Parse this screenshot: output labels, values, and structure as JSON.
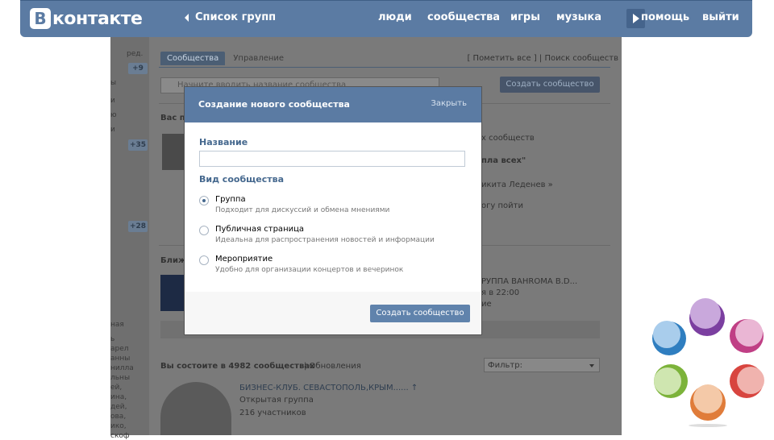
{
  "header": {
    "logo_letter": "В",
    "logo_text": "контакте",
    "back_label": "Список групп",
    "nav": [
      "люди",
      "сообщества",
      "игры",
      "музыка",
      "помощь",
      "выйти"
    ]
  },
  "background": {
    "left_text": [
      "ред.",
      "ы",
      "и",
      "ю",
      "и",
      "ная",
      "ь",
      "арел",
      "анны",
      "нилла",
      "льны",
      "ей,",
      "ина,",
      "дей,",
      "ова,",
      "ико,",
      "скоф"
    ],
    "counters": [
      "+9",
      "+35",
      "+28"
    ],
    "tabs": {
      "active": "Сообщества",
      "other": "Управление"
    },
    "tab_links": "[ Пометить все ] | Поиск сообществ",
    "search_placeholder": "Начните вводить название сообщества",
    "create_button": "Создать сообщество",
    "invites_heading": "Вас пр",
    "right_texts": [
      "х сообществ",
      "пла всех\"",
      "икита Леденев »",
      "огу пойти"
    ],
    "nearby_heading": "Ближ",
    "event_title": "РУППА BAHROMA B.D...",
    "event_time": "я в 22:00",
    "event_extra": "ие",
    "groups_count": "Вы состоите в 4982 сообществах",
    "updates": "| Обновления",
    "filter": "Фильтр:",
    "group_title": "БИЗНЕС-КЛУБ. СЕВАСТОПОЛЬ,КРЫМ...... ↑",
    "group_type": "Открытая группа",
    "group_members": "216 участников"
  },
  "modal": {
    "title": "Создание нового сообщества",
    "close": "Закрыть",
    "name_label": "Название",
    "type_label": "Вид сообщества",
    "options": [
      {
        "title": "Группа",
        "desc": "Подходит для дискуссий и обмена мнениями",
        "selected": true
      },
      {
        "title": "Публичная страница",
        "desc": "Идеальна для распространения новостей и информации",
        "selected": false
      },
      {
        "title": "Мероприятие",
        "desc": "Удобно для организации концертов и вечеринок",
        "selected": false
      }
    ],
    "submit": "Создать сообщество"
  },
  "colors": {
    "vk_blue": "#5b7ba3",
    "link_blue": "#45688e",
    "deco": [
      "#7b3fa0",
      "#c03f85",
      "#2f7ec0",
      "#d8453f",
      "#7cb33a",
      "#e07c3a"
    ]
  }
}
